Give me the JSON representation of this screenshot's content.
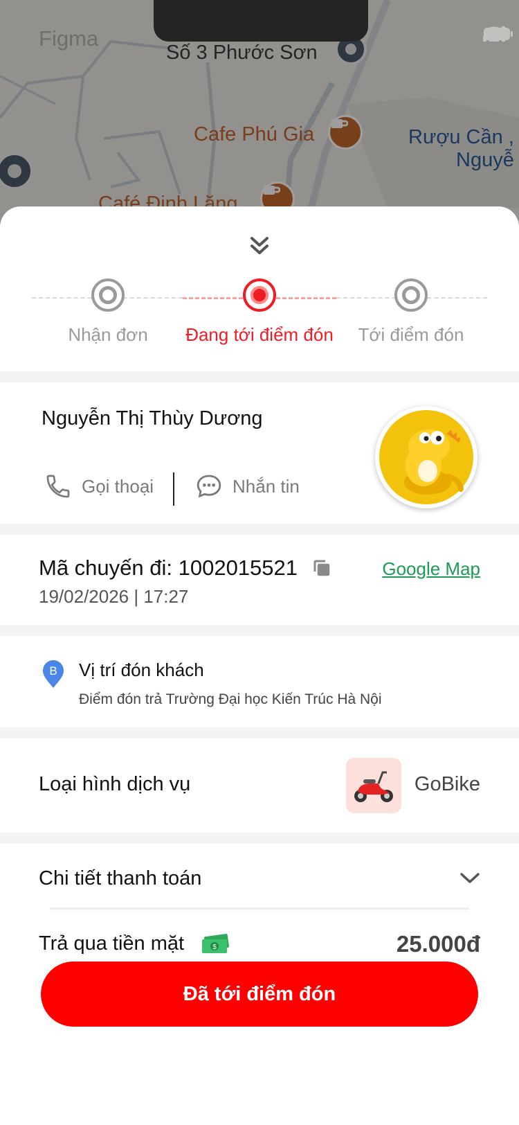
{
  "map": {
    "watermark": "Figma",
    "labels": {
      "street": "Số 3 Phước Sơn",
      "cafe_1": "Cafe Phú Gia",
      "cafe_2": "Café Đinh Lăng",
      "ruou_line1": "Rượu Cần ,",
      "ruou_line2": "Nguyễ"
    }
  },
  "stepper": {
    "steps": [
      {
        "label": "Nhận đơn",
        "state": "done"
      },
      {
        "label": "Đang tới điểm đón",
        "state": "active"
      },
      {
        "label": "Tới điểm đón",
        "state": "pending"
      }
    ],
    "active_color": "#ee1c25"
  },
  "driver": {
    "name": "Nguyễn Thị Thùy Dương",
    "call_label": "Gọi thoại",
    "message_label": "Nhắn tin"
  },
  "trip": {
    "code_label": "Mã chuyến đi: 1002015521",
    "datetime": "19/02/2026 | 17:27",
    "map_link": "Google Map"
  },
  "pickup": {
    "marker": "B",
    "title": "Vị trí đón khách",
    "address": "Điểm đón trả Trường Đại học Kiến Trúc Hà Nội"
  },
  "service": {
    "title": "Loại hình dịch vụ",
    "name": "GoBike"
  },
  "payment": {
    "title": "Chi tiết thanh toán",
    "method": "Trả qua tiền mặt",
    "amount": "25.000đ"
  },
  "cta": {
    "label": "Đã tới điểm đón",
    "color": "#ff0000"
  }
}
